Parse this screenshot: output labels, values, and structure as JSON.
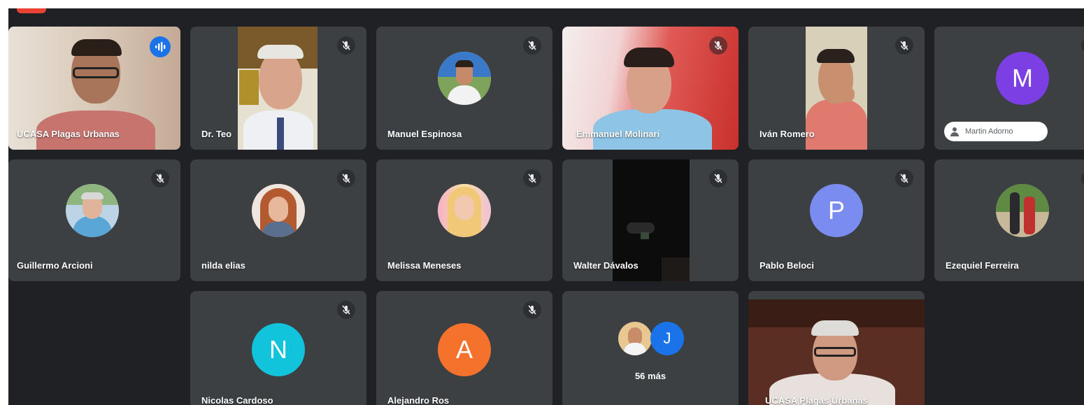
{
  "meeting": {
    "row1": [
      {
        "name": "UCASA Plagas Urbanas",
        "state": "speaking"
      },
      {
        "name": "Dr. Teo",
        "state": "muted"
      },
      {
        "name": "Manuel Espinosa",
        "state": "muted"
      },
      {
        "name": "Emmanuel Molinari",
        "state": "muted"
      },
      {
        "name": "Iván Romero",
        "state": "muted"
      },
      {
        "name": "",
        "state": "muted",
        "avatar_letter": "M",
        "avatar_color": "#7b3fe4",
        "caption_pill": "Martin Adorno"
      }
    ],
    "row2": [
      {
        "name": "Guillermo Arcioni",
        "state": "muted"
      },
      {
        "name": "nilda elias",
        "state": "muted"
      },
      {
        "name": "Melissa Meneses",
        "state": "muted"
      },
      {
        "name": "Walter Dávalos",
        "state": "muted"
      },
      {
        "name": "Pablo Beloci",
        "state": "muted",
        "avatar_letter": "P",
        "avatar_color": "#7a8cf0"
      },
      {
        "name": "Ezequiel Ferreira",
        "state": "muted"
      }
    ],
    "row3": [
      {
        "name": "Nicolas Cardoso",
        "state": "muted",
        "avatar_letter": "N",
        "avatar_color": "#12c3dc"
      },
      {
        "name": "Alejandro Ros",
        "state": "muted",
        "avatar_letter": "A",
        "avatar_color": "#f4722b"
      },
      {
        "more_label": "56 más",
        "more_letter": "J",
        "more_color": "#1a73e8"
      },
      {
        "name": "UCASA Plagas Urbanas",
        "state": "video"
      }
    ]
  },
  "colors": {
    "background": "#202124",
    "tile": "#3c4043",
    "speaking_accent": "#1a73e8",
    "record_badge": "#ea4335"
  },
  "icons": {
    "muted": "mic-off-icon",
    "speaking": "audio-wave-icon",
    "pill": "person-icon"
  }
}
